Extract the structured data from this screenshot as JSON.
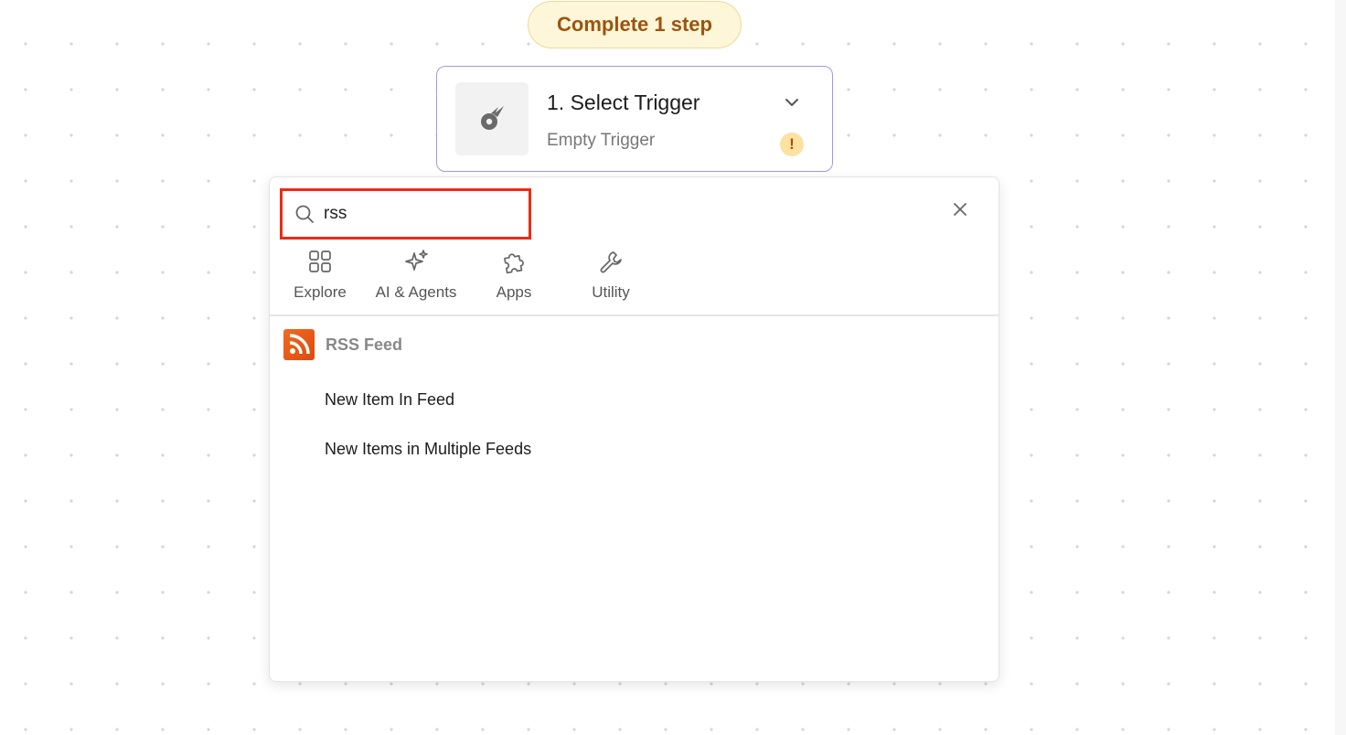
{
  "status_pill": {
    "label": "Complete 1 step"
  },
  "trigger": {
    "title": "1. Select Trigger",
    "subtitle": "Empty Trigger",
    "warning_glyph": "!"
  },
  "search": {
    "value": "rss",
    "placeholder": ""
  },
  "tabs": [
    {
      "label": "Explore",
      "icon": "grid-icon"
    },
    {
      "label": "AI & Agents",
      "icon": "sparkles-icon"
    },
    {
      "label": "Apps",
      "icon": "puzzle-icon"
    },
    {
      "label": "Utility",
      "icon": "wrench-icon"
    }
  ],
  "results": {
    "app_name": "RSS Feed",
    "events": [
      "New Item In Feed",
      "New Items in Multiple Feeds"
    ]
  },
  "colors": {
    "accent_border": "#a695e8",
    "search_highlight": "#ee2b12",
    "rss_orange": "#f26a24",
    "pill_text": "#9b5410"
  }
}
